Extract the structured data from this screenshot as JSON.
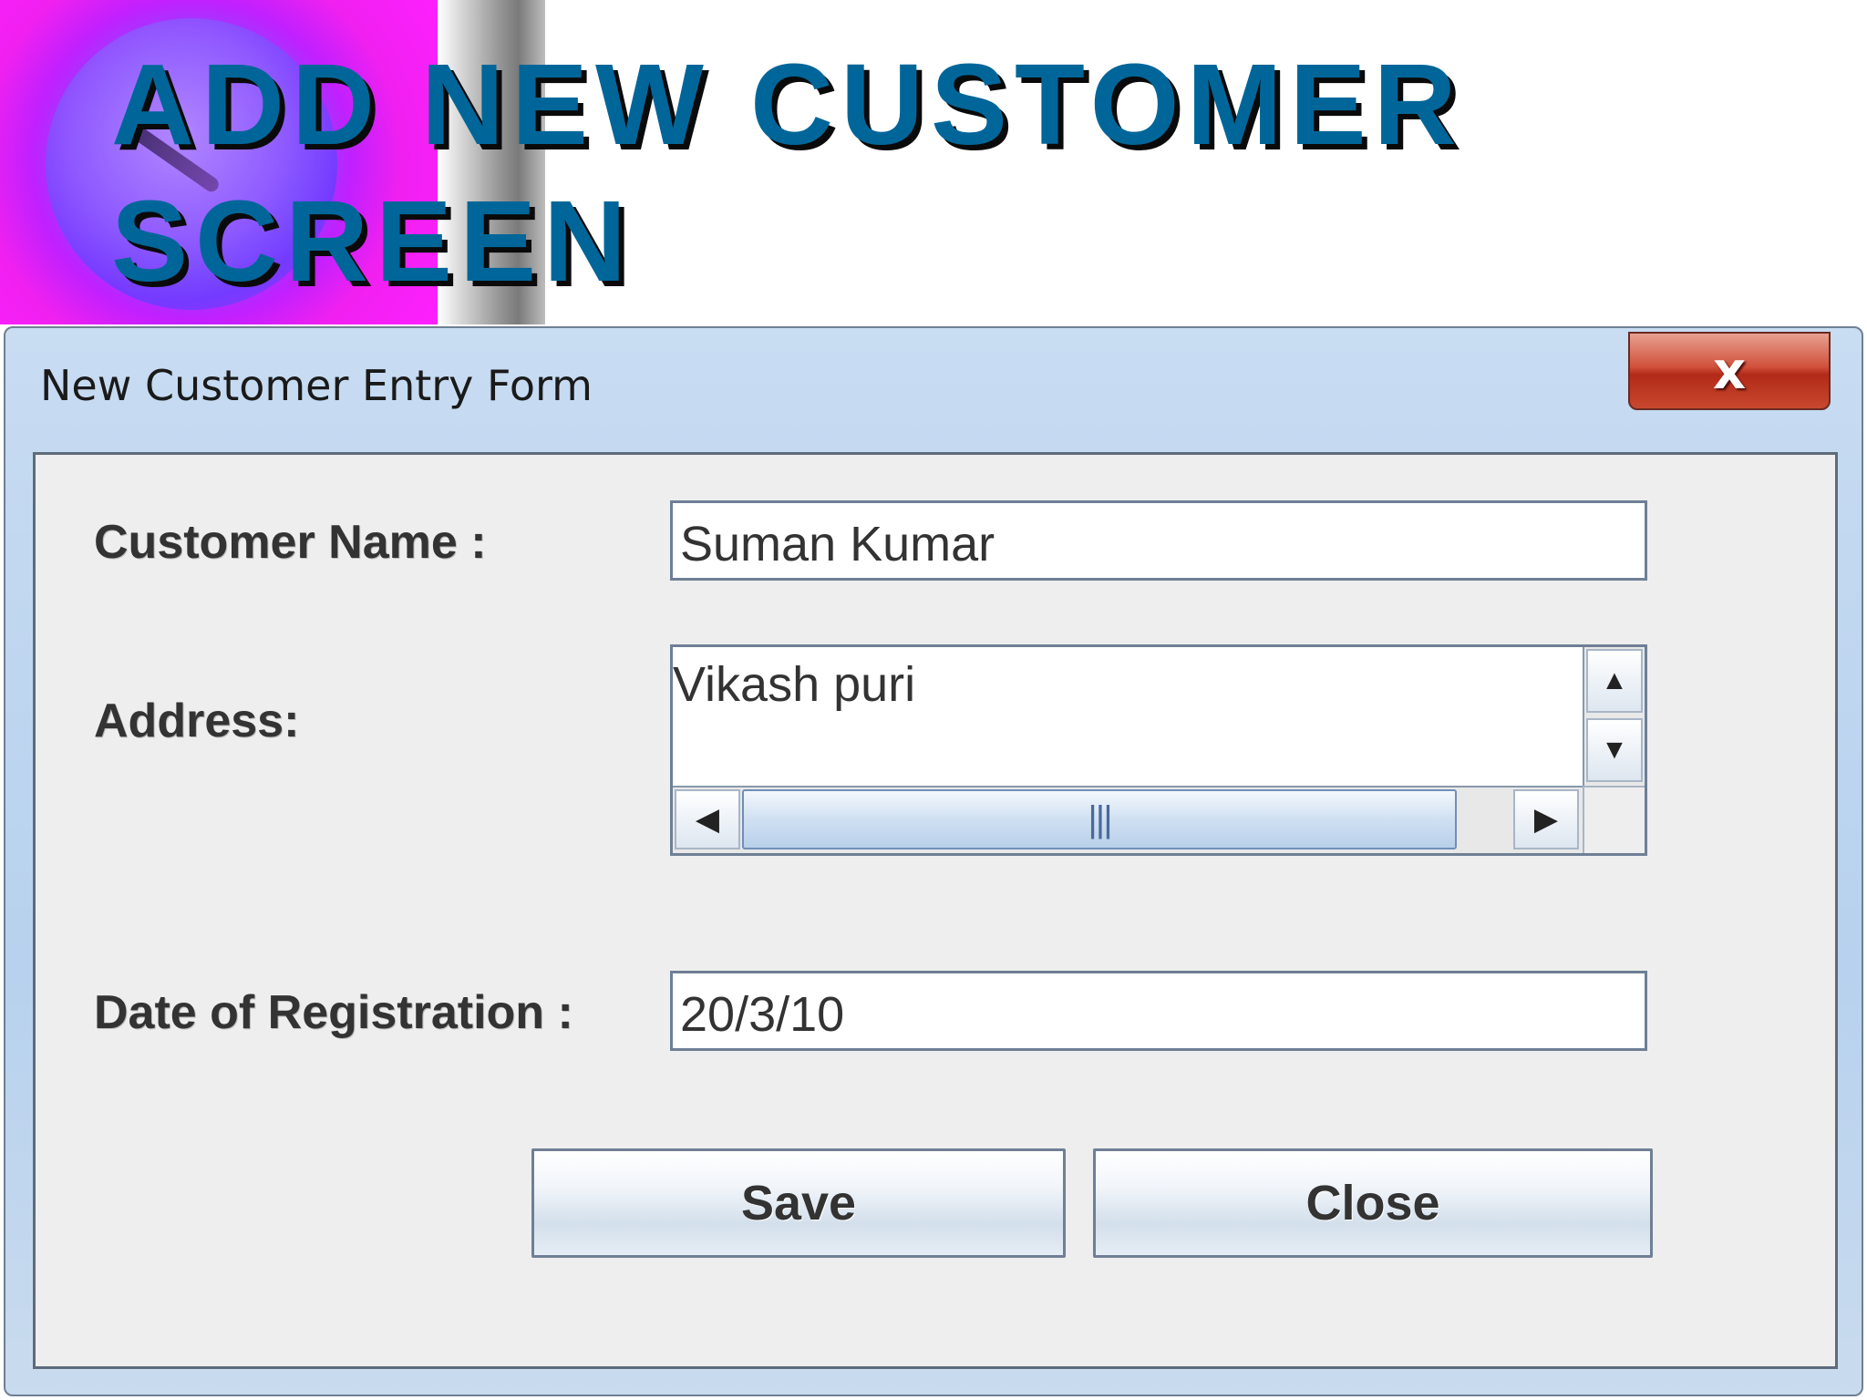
{
  "slide": {
    "title": "ADD NEW CUSTOMER SCREEN"
  },
  "dialog": {
    "window_title": "New Customer Entry Form",
    "close_glyph": "x"
  },
  "form": {
    "customer_name": {
      "label": "Customer Name :",
      "value": "Suman Kumar"
    },
    "address": {
      "label": "Address:",
      "value": "Vikash puri"
    },
    "registration_date": {
      "label": "Date of Registration :",
      "value": "20/3/10"
    }
  },
  "buttons": {
    "save": "Save",
    "close": "Close"
  },
  "scrollbar_glyphs": {
    "up": "▲",
    "down": "▼",
    "left": "◀",
    "right": "▶",
    "grip": "|||"
  },
  "horizontal_scroll_position": 0.0
}
